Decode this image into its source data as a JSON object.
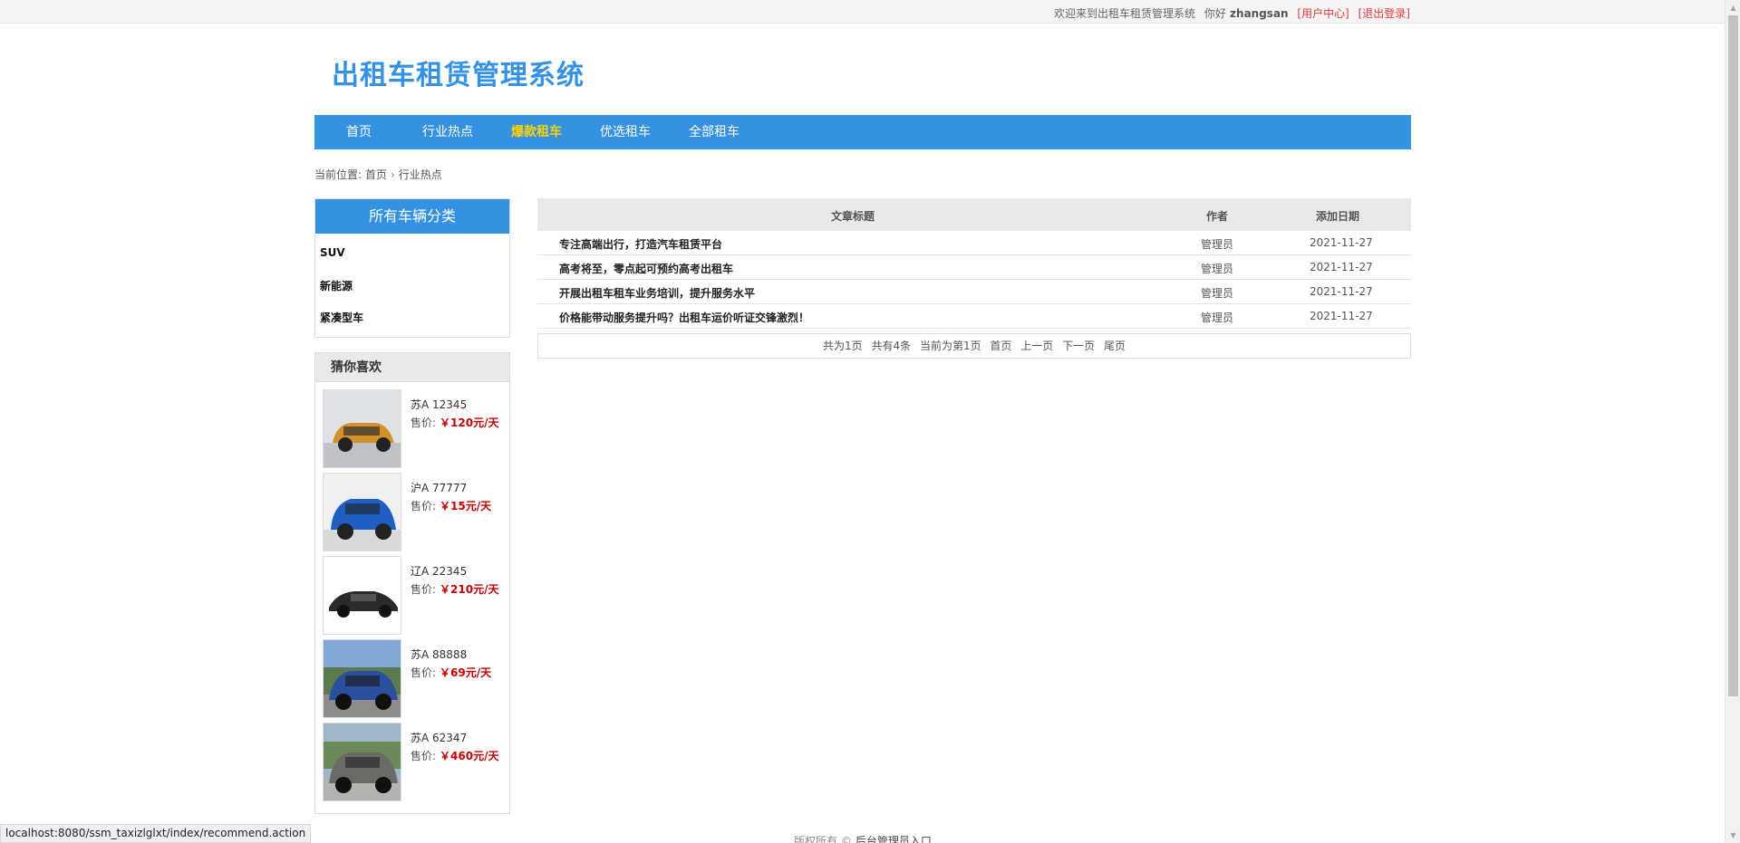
{
  "topbar": {
    "welcome": "欢迎来到出租车租赁管理系统",
    "greeting": "你好",
    "username": "zhangsan",
    "user_center": "[用户中心]",
    "logout": "[退出登录]"
  },
  "logo": "出租车租赁管理系统",
  "nav": [
    {
      "label": "首页"
    },
    {
      "label": "行业热点"
    },
    {
      "label": "爆款租车"
    },
    {
      "label": "优选租车"
    },
    {
      "label": "全部租车"
    }
  ],
  "breadcrumb": {
    "prefix": "当前位置:",
    "home": "首页",
    "sep": "›",
    "current": "行业热点"
  },
  "categories": {
    "title": "所有车辆分类",
    "items": [
      "SUV",
      "新能源",
      "紧凑型车"
    ]
  },
  "recommend": {
    "title": "猜你喜欢",
    "price_label": "售价:",
    "cars": [
      {
        "plate": "苏A 12345",
        "price": "￥120元/天",
        "color": "#d4902a"
      },
      {
        "plate": "沪A 77777",
        "price": "￥15元/天",
        "color": "#1f5fc4"
      },
      {
        "plate": "辽A 22345",
        "price": "￥210元/天",
        "color": "#2a2a2a"
      },
      {
        "plate": "苏A 88888",
        "price": "￥69元/天",
        "color": "#2a4f9c"
      },
      {
        "plate": "苏A 62347",
        "price": "￥460元/天",
        "color": "#6b6a66"
      }
    ]
  },
  "table": {
    "headers": {
      "title": "文章标题",
      "author": "作者",
      "date": "添加日期"
    },
    "rows": [
      {
        "title": "专注高端出行，打造汽车租赁平台",
        "author": "管理员",
        "date": "2021-11-27"
      },
      {
        "title": "高考将至，零点起可预约高考出租车",
        "author": "管理员",
        "date": "2021-11-27"
      },
      {
        "title": "开展出租车租车业务培训，提升服务水平",
        "author": "管理员",
        "date": "2021-11-27"
      },
      {
        "title": "价格能带动服务提升吗？出租车运价听证交锋激烈！",
        "author": "管理员",
        "date": "2021-11-27"
      }
    ]
  },
  "pager": {
    "total_pages": "共为1页",
    "total_items": "共有4条",
    "current": "当前为第1页",
    "first": "首页",
    "prev": "上一页",
    "next": "下一页",
    "last": "尾页"
  },
  "footer": {
    "copyright": "版权所有 ©",
    "admin_link": "后台管理员入口"
  },
  "statusbar": "localhost:8080/ssm_taxizlglxt/index/recommend.action"
}
